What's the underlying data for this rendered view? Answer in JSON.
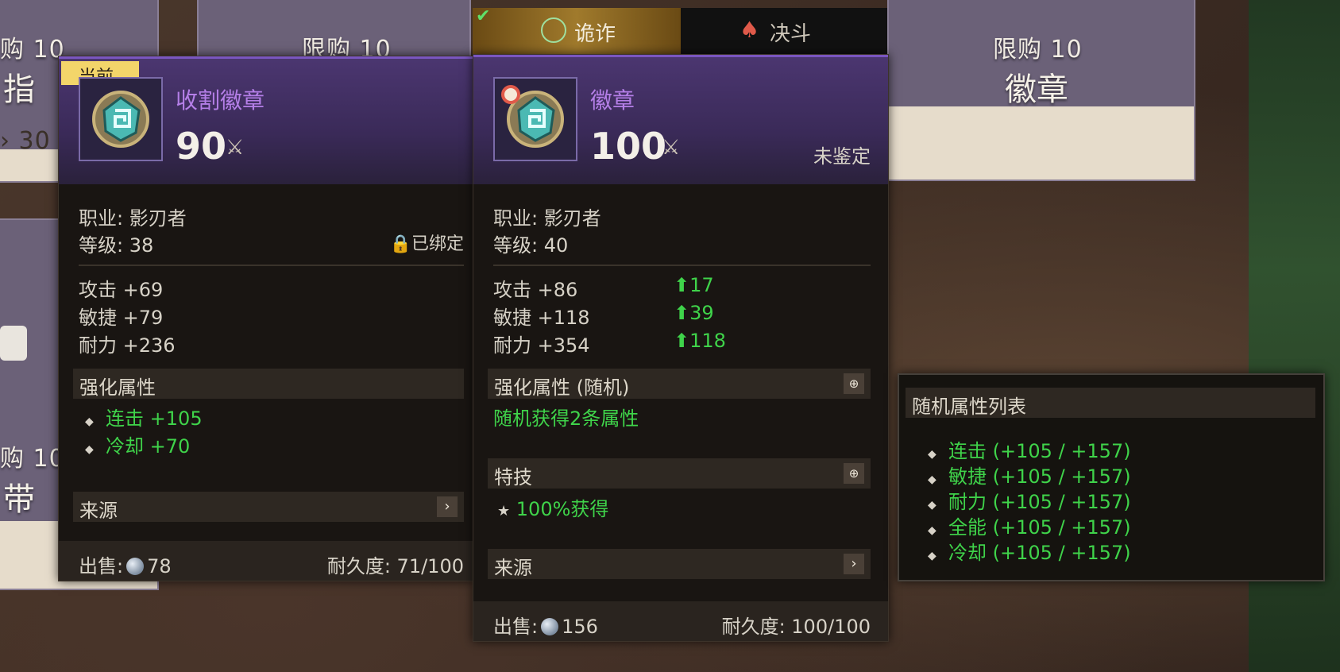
{
  "shop": {
    "limit_left_top": "购 10",
    "limit_mid_top": "限购 10",
    "limit_right_top": "限购 10",
    "title_left_top": "指",
    "title_right_top": "徽章",
    "price_left": "30",
    "limit_left_bottom": "购 10",
    "title_left_bottom": "带"
  },
  "current_item": {
    "badge": "当前",
    "name": "收割徽章",
    "score": "90",
    "class_line": "职业: 影刃者",
    "level_line": "等级: 38",
    "bound": "已绑定",
    "stats": [
      "攻击 +69",
      "敏捷 +79",
      "耐力 +236"
    ],
    "enhance_title": "强化属性",
    "enhance": [
      "连击 +105",
      "冷却 +70"
    ],
    "source_title": "来源",
    "sell_label": "出售:",
    "sell_value": "78",
    "durability": "耐久度: 71/100"
  },
  "new_item": {
    "tabs": [
      "诡诈",
      "决斗"
    ],
    "name": "徽章",
    "score": "100",
    "unidentified": "未鉴定",
    "class_line": "职业: 影刃者",
    "level_line": "等级: 40",
    "stats": [
      "攻击 +86",
      "敏捷 +118",
      "耐力 +354"
    ],
    "stat_diffs": [
      "17",
      "39",
      "118"
    ],
    "enhance_title": "强化属性 (随机)",
    "enhance_desc": "随机获得2条属性",
    "skill_title": "特技",
    "skill_desc": "100%获得",
    "source_title": "来源",
    "sell_label": "出售:",
    "sell_value": "156",
    "durability": "耐久度: 100/100"
  },
  "random_list": {
    "title": "随机属性列表",
    "items": [
      "连击 (+105 / +157)",
      "敏捷 (+105 / +157)",
      "耐力 (+105 / +157)",
      "全能 (+105 / +157)",
      "冷却 (+105 / +157)"
    ]
  },
  "colors": {
    "name_purple": "#b57fe8",
    "stat_green": "#3fd34a",
    "header_purple": "#4b3670"
  }
}
